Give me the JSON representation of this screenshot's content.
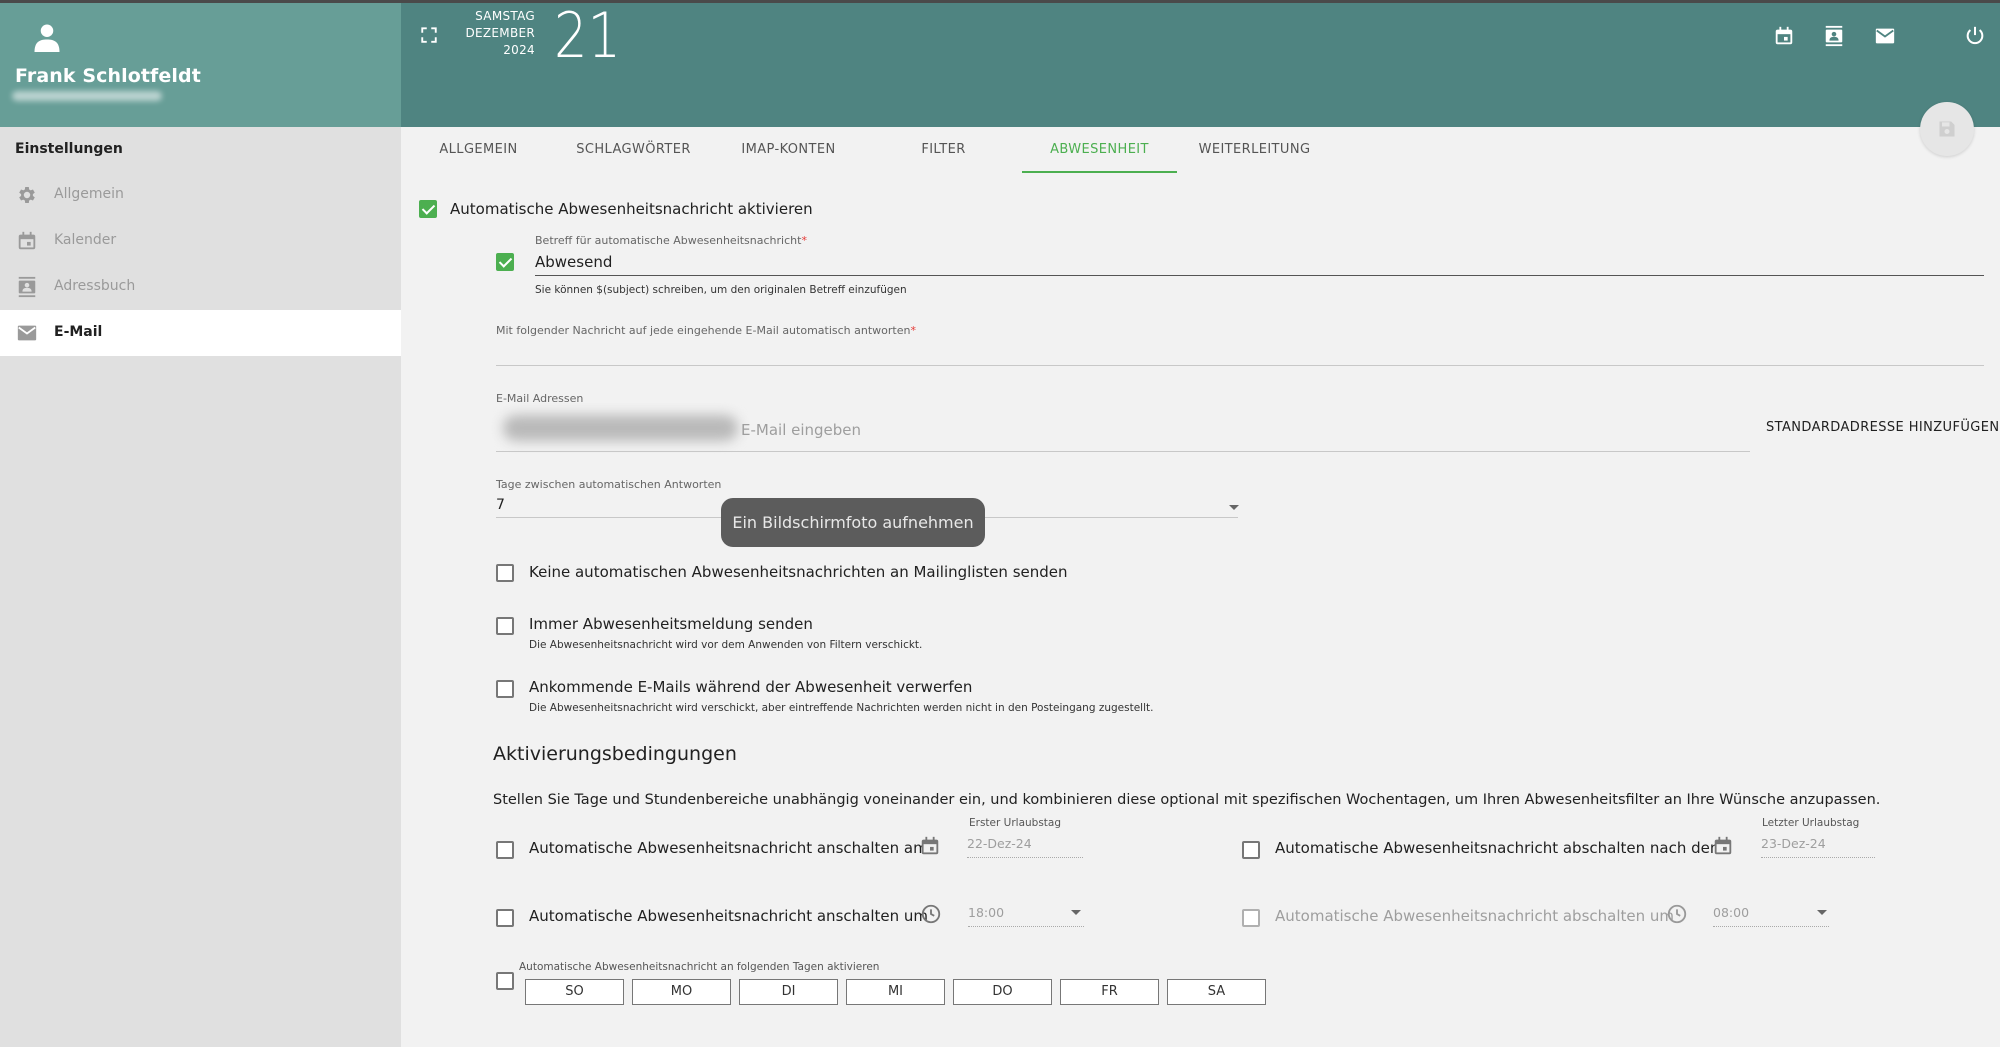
{
  "user": {
    "name": "Frank Schlotfeldt"
  },
  "sidebar": {
    "title": "Einstellungen",
    "items": [
      {
        "label": "Allgemein",
        "icon": "gear-icon"
      },
      {
        "label": "Kalender",
        "icon": "calendar-icon"
      },
      {
        "label": "Adressbuch",
        "icon": "contacts-icon"
      },
      {
        "label": "E-Mail",
        "icon": "mail-icon",
        "active": true
      }
    ]
  },
  "header": {
    "weekday": "SAMSTAG",
    "month": "DEZEMBER",
    "year": "2024",
    "day": "21"
  },
  "tabs": [
    {
      "label": "ALLGEMEIN"
    },
    {
      "label": "SCHLAGWÖRTER"
    },
    {
      "label": "IMAP-KONTEN"
    },
    {
      "label": "FILTER"
    },
    {
      "label": "ABWESENHEIT",
      "active": true
    },
    {
      "label": "WEITERLEITUNG"
    }
  ],
  "form": {
    "enable_label": "Automatische Abwesenheitsnachricht aktivieren",
    "subject_label": "Betreff für automatische Abwesenheitsnachricht",
    "subject_required": "*",
    "subject_value": "Abwesend",
    "subject_hint": "Sie können $(subject) schreiben, um den originalen Betreff einzufügen",
    "message_label": "Mit folgender Nachricht auf jede eingehende E-Mail automatisch antworten",
    "message_required": "*",
    "email_label": "E-Mail Adressen",
    "email_placeholder": "E-Mail eingeben",
    "add_default_label": "STANDARDADRESSE HINZUFÜGEN",
    "days_label": "Tage zwischen automatischen Antworten",
    "days_value": "7",
    "no_mailinglists_label": "Keine automatischen Abwesenheitsnachrichten an Mailinglisten senden",
    "always_send_label": "Immer Abwesenheitsmeldung senden",
    "always_send_hint": "Die Abwesenheitsnachricht wird vor dem Anwenden von Filtern verschickt.",
    "discard_label": "Ankommende E-Mails während der Abwesenheit verwerfen",
    "discard_hint": "Die Abwesenheitsnachricht wird verschickt, aber eintreffende Nachrichten werden nicht in den Posteingang zugestellt."
  },
  "conditions": {
    "title": "Aktivierungsbedingungen",
    "description": "Stellen Sie Tage und Stundenbereiche unabhängig voneinander ein, und kombinieren diese optional mit spezifischen Wochentagen, um Ihren Abwesenheitsfilter an Ihre Wünsche anzupassen.",
    "enable_on_date_label": "Automatische Abwesenheitsnachricht anschalten am",
    "first_day_label": "Erster Urlaubstag",
    "first_day_value": "22-Dez-24",
    "disable_after_date_label": "Automatische Abwesenheitsnachricht abschalten nach dem",
    "last_day_label": "Letzter Urlaubstag",
    "last_day_value": "23-Dez-24",
    "enable_at_time_label": "Automatische Abwesenheitsnachricht anschalten um",
    "enable_time_value": "18:00",
    "disable_at_time_label": "Automatische Abwesenheitsnachricht abschalten um",
    "disable_time_value": "08:00",
    "weekdays_label": "Automatische Abwesenheitsnachricht an folgenden Tagen aktivieren",
    "weekdays": [
      "SO",
      "MO",
      "DI",
      "MI",
      "DO",
      "FR",
      "SA"
    ]
  },
  "toast": {
    "text": "Ein Bildschirmfoto aufnehmen"
  },
  "colors": {
    "accent": "#4caf50",
    "sidebar_header": "#679e97",
    "topbar": "#4f8481"
  }
}
